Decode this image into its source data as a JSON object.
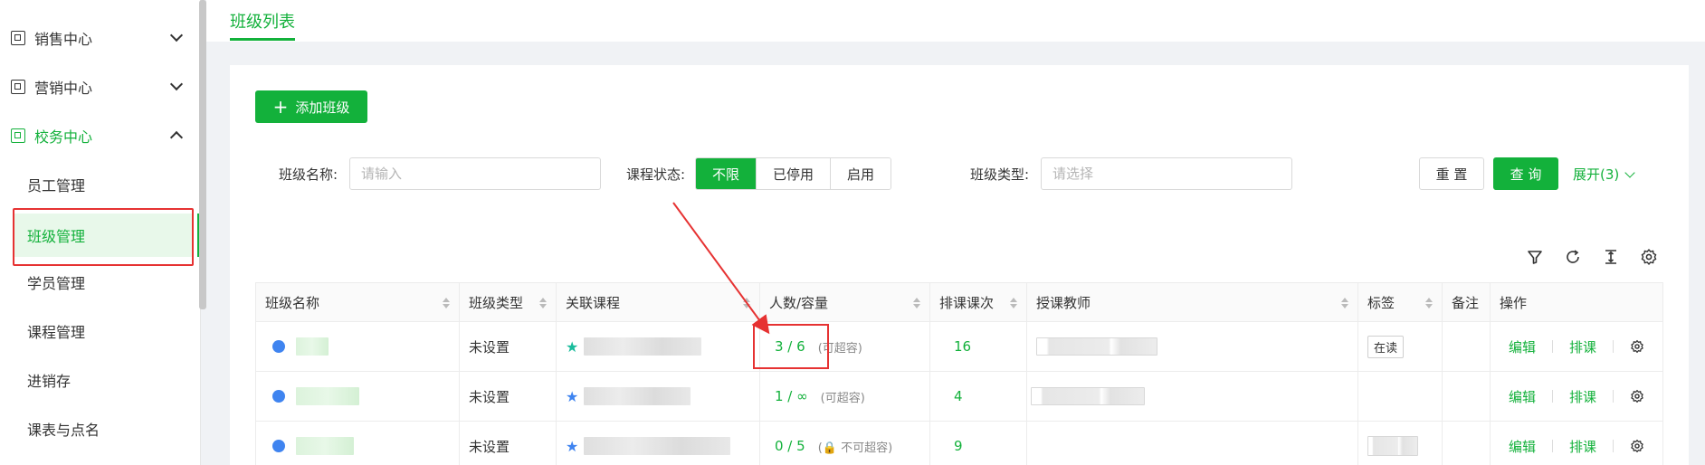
{
  "sidebar": {
    "groups": [
      {
        "label": "销售中心"
      },
      {
        "label": "营销中心"
      },
      {
        "label": "校务中心"
      }
    ],
    "items": [
      {
        "label": "员工管理"
      },
      {
        "label": "班级管理"
      },
      {
        "label": "学员管理"
      },
      {
        "label": "课程管理"
      },
      {
        "label": "进销存"
      },
      {
        "label": "课表与点名"
      }
    ]
  },
  "header": {
    "tab_title": "班级列表"
  },
  "toolbar": {
    "add_label": "添加班级"
  },
  "filters": {
    "class_name_label": "班级名称:",
    "class_name_placeholder": "请输入",
    "status_label": "课程状态:",
    "status_options": [
      "不限",
      "已停用",
      "启用"
    ],
    "class_type_label": "班级类型:",
    "class_type_placeholder": "请选择",
    "reset_label": "重 置",
    "query_label": "查 询",
    "expand_label": "展开(3)"
  },
  "table": {
    "columns": [
      "班级名称",
      "班级类型",
      "关联课程",
      "人数/容量",
      "排课课次",
      "授课教师",
      "标签",
      "备注",
      "操作"
    ],
    "rows": [
      {
        "type": "未设置",
        "capacity": "3 / 6",
        "capacity_note": "(可超容)",
        "sessions": "16",
        "tag": "在读",
        "edit": "编辑",
        "schedule": "排课"
      },
      {
        "type": "未设置",
        "capacity": "1 / ∞",
        "capacity_note": "(可超容)",
        "sessions": "4",
        "tag": "",
        "edit": "编辑",
        "schedule": "排课"
      },
      {
        "type": "未设置",
        "capacity": "0 / 5",
        "capacity_note": "(🔒 不可超容)",
        "sessions": "9",
        "tag": "",
        "edit": "编辑",
        "schedule": "排课"
      }
    ]
  },
  "colors": {
    "accent": "#13b13b",
    "annotation": "#e63232",
    "dot": "#3f84f0"
  }
}
